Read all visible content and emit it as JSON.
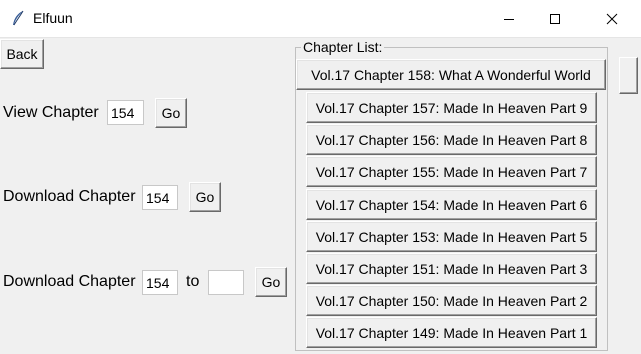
{
  "window": {
    "title": "Elfuun"
  },
  "nav": {
    "back_label": "Back"
  },
  "view": {
    "label": "View Chapter",
    "value": "154",
    "go_label": "Go"
  },
  "download": {
    "label": "Download Chapter",
    "value": "154",
    "go_label": "Go"
  },
  "range": {
    "label": "Download Chapter",
    "from_value": "154",
    "to_label": "to",
    "to_value": "",
    "go_label": "Go"
  },
  "chapter_list": {
    "title": "Chapter List:",
    "items": [
      "Vol.17 Chapter 158: What A Wonderful World",
      "Vol.17 Chapter 157: Made In Heaven Part 9",
      "Vol.17 Chapter 156: Made In Heaven Part 8",
      "Vol.17 Chapter 155: Made In Heaven Part 7",
      "Vol.17 Chapter 154: Made In Heaven Part 6",
      "Vol.17 Chapter 153: Made In Heaven Part 5",
      "Vol.17 Chapter 151: Made In Heaven Part 3",
      "Vol.17 Chapter 150: Made In Heaven Part 2",
      "Vol.17 Chapter 149: Made In Heaven Part 1"
    ]
  },
  "icons": {
    "app": "feather-icon",
    "minimize": "minimize-icon",
    "maximize": "maximize-icon",
    "close": "close-icon"
  }
}
